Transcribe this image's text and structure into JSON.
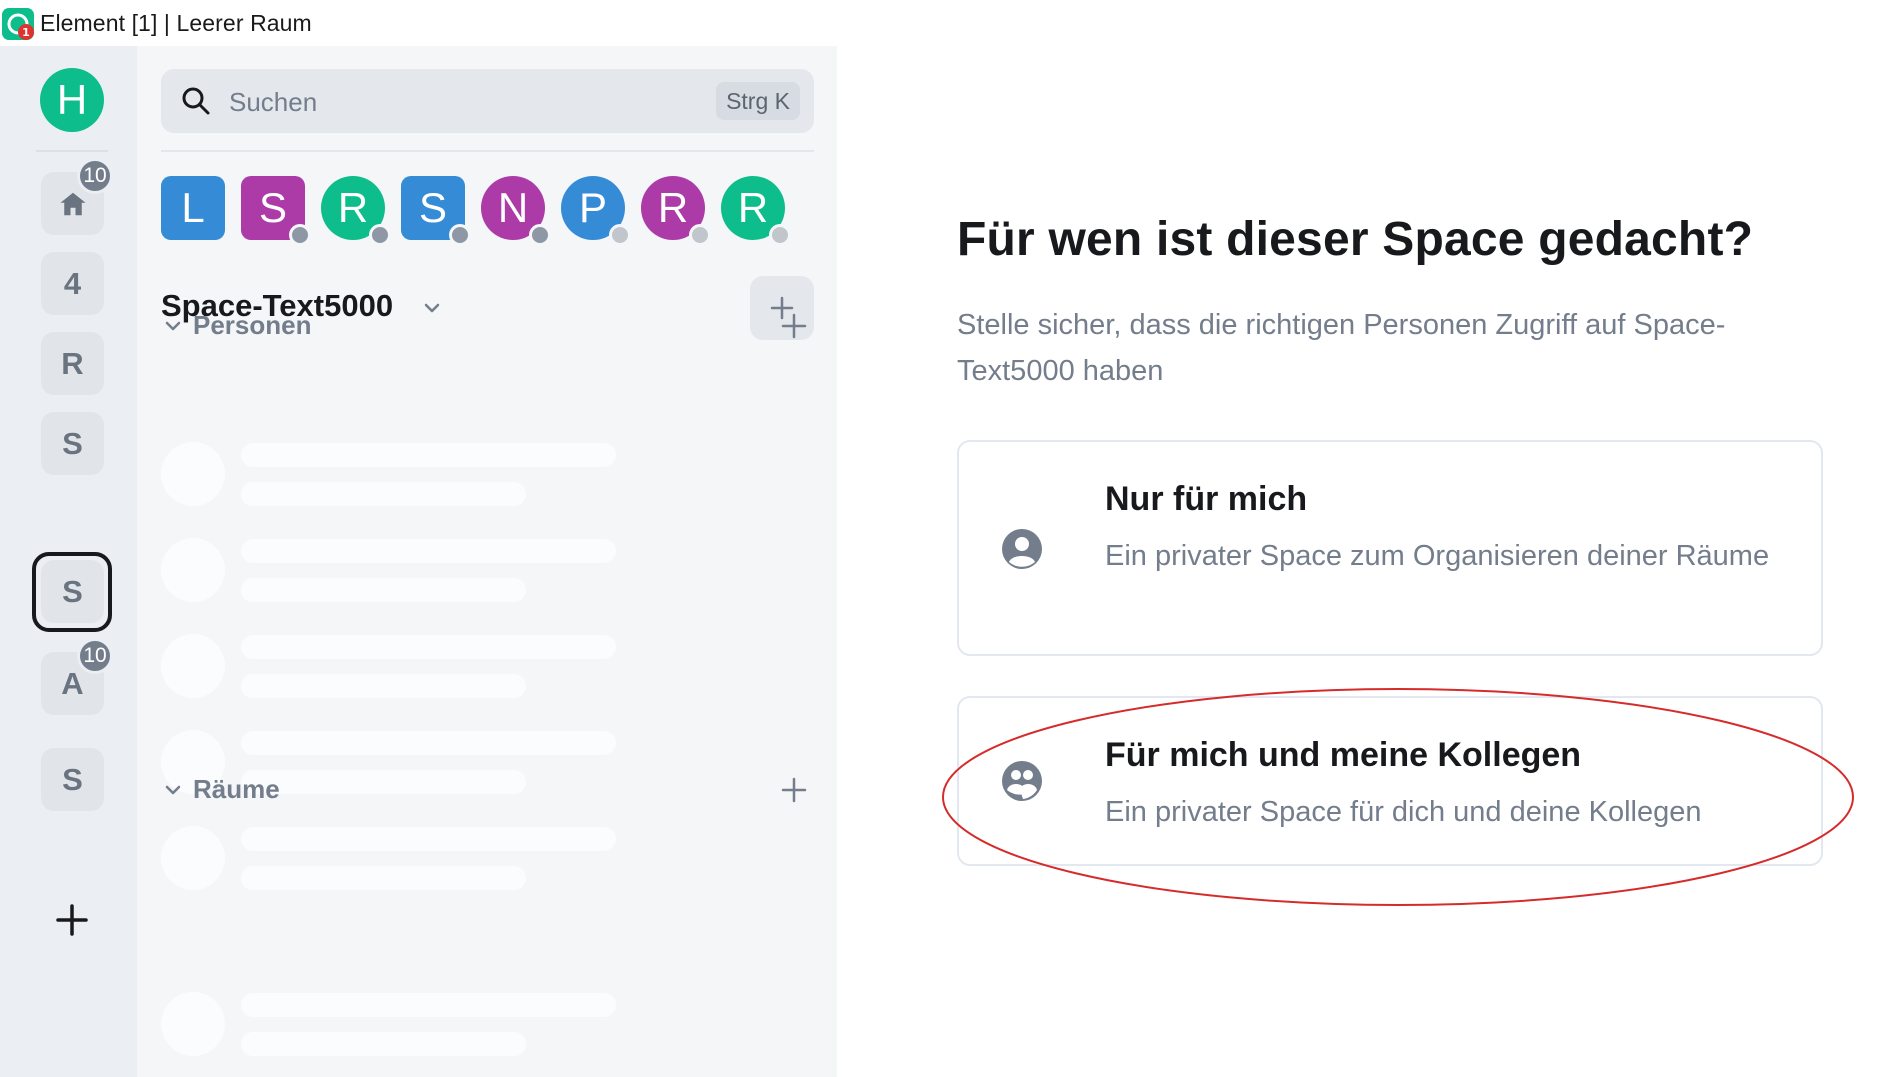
{
  "window": {
    "title": "Element [1] | Leerer Raum"
  },
  "spacebar": {
    "home_avatar_letter": "H",
    "home_badge": "10",
    "items": [
      {
        "letter": "4"
      },
      {
        "letter": "R"
      },
      {
        "letter": "S"
      },
      {
        "letter": "S",
        "selected": true
      },
      {
        "letter": "A",
        "badge": "10"
      },
      {
        "letter": "S"
      }
    ]
  },
  "roomlist": {
    "search_placeholder": "Suchen",
    "search_shortcut": "Strg K",
    "recent_dms": [
      {
        "letter": "L",
        "color": "#368bd6",
        "shape": "square",
        "presence": "none"
      },
      {
        "letter": "S",
        "color": "#ac3ba8",
        "shape": "square",
        "presence": "globe"
      },
      {
        "letter": "R",
        "color": "#0dbd8b",
        "shape": "circle",
        "presence": "globe"
      },
      {
        "letter": "S",
        "color": "#368bd6",
        "shape": "square",
        "presence": "globe"
      },
      {
        "letter": "N",
        "color": "#ac3ba8",
        "shape": "circle",
        "presence": "globe"
      },
      {
        "letter": "P",
        "color": "#368bd6",
        "shape": "circle",
        "presence": "offline"
      },
      {
        "letter": "R",
        "color": "#ac3ba8",
        "shape": "circle",
        "presence": "offline"
      },
      {
        "letter": "R",
        "color": "#0dbd8b",
        "shape": "circle",
        "presence": "offline"
      }
    ],
    "space_name": "Space-Text5000",
    "sections": {
      "people": "Personen",
      "rooms": "Räume"
    }
  },
  "main": {
    "heading": "Für wen ist dieser Space gedacht?",
    "subheading": "Stelle sicher, dass die richtigen Personen Zugriff auf Space-Text5000 haben",
    "options": [
      {
        "title": "Nur für mich",
        "description": "Ein privater Space zum Organisieren deiner Räume",
        "icon": "person-icon"
      },
      {
        "title": "Für mich und meine Kollegen",
        "description": "Ein privater Space für dich und deine Kollegen",
        "icon": "group-icon",
        "highlighted": true
      }
    ]
  },
  "colors": {
    "accent_green": "#0dbd8b",
    "highlight_ellipse": "#d62b2b"
  }
}
